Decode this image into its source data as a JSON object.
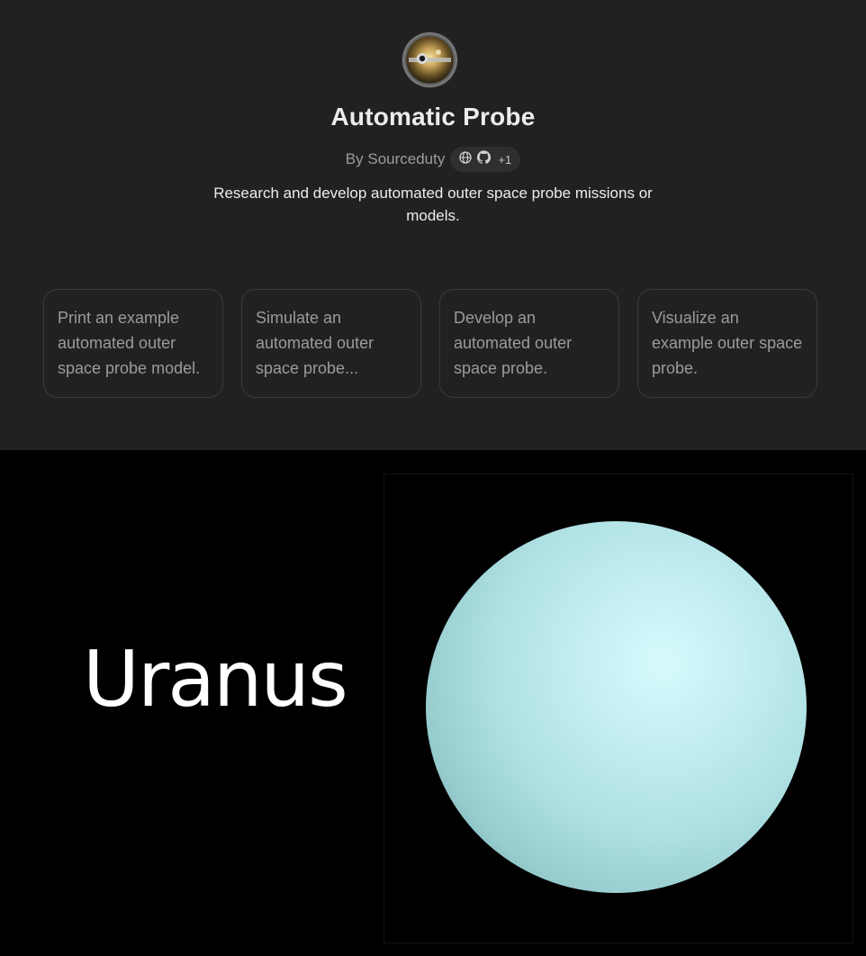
{
  "gpt": {
    "name": "Automatic Probe",
    "author_line": "By Sourceduty",
    "extra_links_count": "+1",
    "description": "Research and develop automated outer space probe missions or models."
  },
  "conversation_starters": [
    "Print an example automated outer space probe model.",
    "Simulate an automated outer space probe...",
    "Develop an automated outer space probe.",
    "Visualize an example outer space probe."
  ],
  "media": {
    "label": "Uranus"
  },
  "icons": {
    "website": "globe-icon",
    "repository": "github-icon"
  },
  "colors": {
    "background": "#212121",
    "title": "#ececec",
    "muted_text": "#9b9b9b",
    "planet": "#c4eef1"
  }
}
